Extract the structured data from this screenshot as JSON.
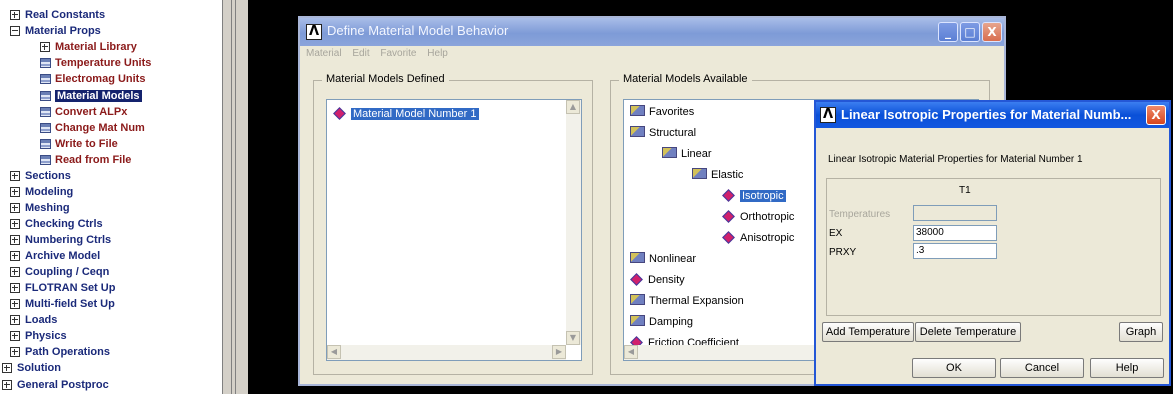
{
  "tree": {
    "items": [
      {
        "label": "Real Constants",
        "kind": "plus"
      },
      {
        "label": "Material Props",
        "kind": "minus"
      },
      {
        "label": "Material Library",
        "kind": "plus-sub"
      },
      {
        "label": "Temperature Units",
        "kind": "leaf"
      },
      {
        "label": "Electromag Units",
        "kind": "leaf"
      },
      {
        "label": "Material Models",
        "kind": "leaf-selected"
      },
      {
        "label": "Convert ALPx",
        "kind": "leaf"
      },
      {
        "label": "Change Mat Num",
        "kind": "leaf"
      },
      {
        "label": "Write to File",
        "kind": "leaf"
      },
      {
        "label": "Read from File",
        "kind": "leaf"
      },
      {
        "label": "Sections",
        "kind": "plus"
      },
      {
        "label": "Modeling",
        "kind": "plus"
      },
      {
        "label": "Meshing",
        "kind": "plus"
      },
      {
        "label": "Checking Ctrls",
        "kind": "plus"
      },
      {
        "label": "Numbering Ctrls",
        "kind": "plus"
      },
      {
        "label": "Archive Model",
        "kind": "plus"
      },
      {
        "label": "Coupling / Ceqn",
        "kind": "plus"
      },
      {
        "label": "FLOTRAN Set Up",
        "kind": "plus"
      },
      {
        "label": "Multi-field Set Up",
        "kind": "plus"
      },
      {
        "label": "Loads",
        "kind": "plus"
      },
      {
        "label": "Physics",
        "kind": "plus"
      },
      {
        "label": "Path Operations",
        "kind": "plus"
      },
      {
        "label": "Solution",
        "kind": "plus-top"
      },
      {
        "label": "General Postproc",
        "kind": "plus-top"
      }
    ]
  },
  "dialog1": {
    "title": "Define Material Model Behavior",
    "menu": [
      "Material",
      "Edit",
      "Favorite",
      "Help"
    ],
    "defined_label": "Material Models Defined",
    "defined_item": "Material Model Number 1",
    "available_label": "Material Models Available",
    "available": {
      "favorites": "Favorites",
      "structural": "Structural",
      "linear": "Linear",
      "elastic": "Elastic",
      "isotropic": "Isotropic",
      "orthotropic": "Orthotropic",
      "anisotropic": "Anisotropic",
      "nonlinear": "Nonlinear",
      "density": "Density",
      "thermal_expansion": "Thermal Expansion",
      "damping": "Damping",
      "friction": "Friction Coefficient"
    },
    "controls": {
      "minimize": "_",
      "maximize": "□",
      "close": "X"
    }
  },
  "dialog2": {
    "title": "Linear Isotropic Properties for Material Numb...",
    "subtitle": "Linear Isotropic Material Properties for Material Number 1",
    "col_header": "T1",
    "rows": [
      {
        "label": "Temperatures",
        "value": ""
      },
      {
        "label": "EX",
        "value": "38000"
      },
      {
        "label": "PRXY",
        "value": ".3"
      }
    ],
    "buttons": {
      "add_temp": "Add Temperature",
      "del_temp": "Delete Temperature",
      "graph": "Graph",
      "ok": "OK",
      "cancel": "Cancel",
      "help": "Help"
    },
    "close": "X"
  },
  "colors": {
    "tree_nav": "#1b2a7a",
    "tree_matprops": "#8b1a1a",
    "selection": "#316ac5",
    "xp_title": "#0a50d8"
  }
}
